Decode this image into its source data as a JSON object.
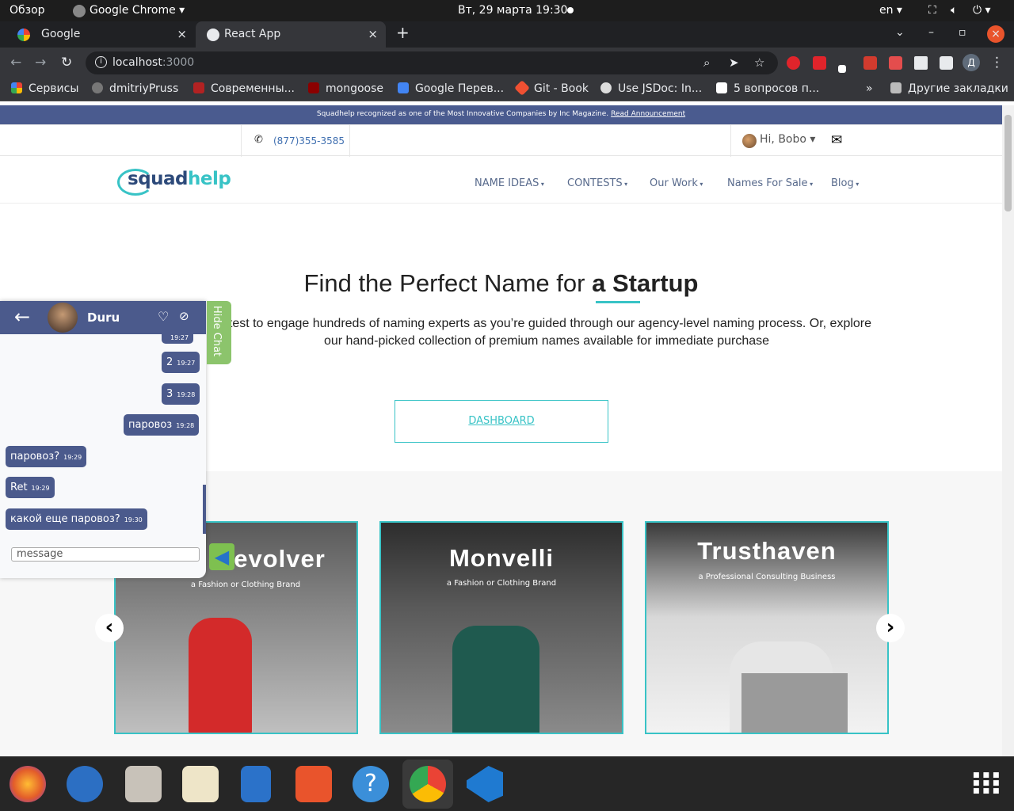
{
  "system": {
    "overview": "Обзор",
    "app": "Google Chrome ▾",
    "datetime": "Вт, 29 марта  19:30",
    "lang": "en ▾"
  },
  "tabs": [
    {
      "label": "Google"
    },
    {
      "label": "React App"
    }
  ],
  "omnibox": {
    "host": "localhost",
    "port": ":3000"
  },
  "bookmarks": [
    {
      "label": "Сервисы",
      "color": "#ea4335"
    },
    {
      "label": "dmitriyPruss",
      "color": "#777777"
    },
    {
      "label": "Современны...",
      "color": "#b22222"
    },
    {
      "label": "mongoose",
      "color": "#8b0000"
    },
    {
      "label": "Google Перев...",
      "color": "#4285f4"
    },
    {
      "label": "Git - Book",
      "color": "#f05032"
    },
    {
      "label": "Use JSDoc: In...",
      "color": "#dddddd"
    },
    {
      "label": "5 вопросов п...",
      "color": "#ffffff"
    },
    {
      "label": "»",
      "color": ""
    },
    {
      "label": "Другие закладки",
      "color": "#bbbbbb"
    }
  ],
  "banner": {
    "text": "Squadhelp recognized as one of the Most Innovative Companies by Inc Magazine.",
    "link": "Read Announcement"
  },
  "contact": {
    "phone": "(877)355-3585",
    "greeting": "Hi, Bobo ▾"
  },
  "logo": {
    "part1": "squad",
    "part2": "help"
  },
  "nav": [
    "NAME IDEAS",
    "CONTESTS",
    "Our Work",
    "Names For Sale",
    "Blog"
  ],
  "hero": {
    "title_start": "Find the Perfect Name for",
    "title_bold": "a Startup",
    "line1": "ntest to engage hundreds of naming experts as you’re guided through our agency-level naming process. Or, explore",
    "line2": "our hand-picked collection of premium names available for immediate purchase",
    "button": "DASHBOARD"
  },
  "cards": [
    {
      "name": "evolver",
      "tagline": "a Fashion or Clothing Brand"
    },
    {
      "name": "Monvelli",
      "tagline": "a Fashion or Clothing Brand"
    },
    {
      "name": "Trusthaven",
      "tagline": "a Professional Consulting Business"
    }
  ],
  "chat": {
    "contact": "Duru",
    "hide": "Hide Chat",
    "placeholder": "message",
    "messages": [
      {
        "text": "",
        "time": "19:27"
      },
      {
        "text": "2",
        "time": "19:27"
      },
      {
        "text": "3",
        "time": "19:28"
      },
      {
        "text": "паровоз",
        "time": "19:28"
      },
      {
        "text": "паровоз?",
        "time": "19:29"
      },
      {
        "text": "Ret",
        "time": "19:29"
      },
      {
        "text": "какой еще паровоз?",
        "time": "19:30"
      }
    ]
  },
  "icons": {
    "close": "×",
    "new_tab": "+",
    "back": "←",
    "forward": "→",
    "reload": "↻",
    "search": "⌕",
    "share": "➤",
    "star": "☆",
    "phone": "✆",
    "mail": "✉",
    "heart": "♡",
    "block": "⊘",
    "send": "◀",
    "left": "‹",
    "right": "›"
  }
}
